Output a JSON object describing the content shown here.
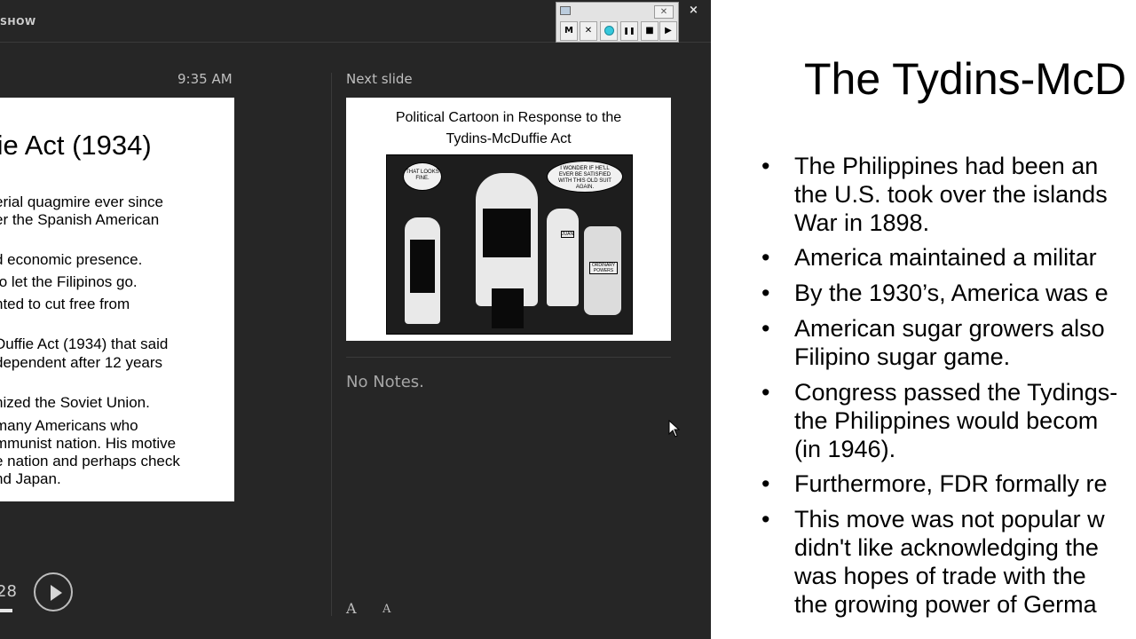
{
  "presenter": {
    "title_fragment": "SHOW",
    "close_glyph": "×",
    "clock": "9:35 AM",
    "timer_fragment": "28",
    "next_slide_label": "Next slide",
    "notes": "No Notes.",
    "font_increase_glyph": "A",
    "font_decrease_glyph": "A"
  },
  "current_slide": {
    "title": "ffie Act (1934)",
    "lines": [
      "erial quagmire ever since",
      "er the Spanish American",
      "d economic presence.",
      "to let the Filipinos go.",
      "nted to cut free from",
      "Duffie Act (1934) that said",
      "dependent after 12 years",
      "nized the Soviet Union.",
      "many Americans who",
      "mmunist nation. His motive",
      "e nation and perhaps check",
      "nd Japan."
    ]
  },
  "next_slide": {
    "title_line1": "Political Cartoon in Response to the",
    "title_line2": "Tydins-McDuffie Act",
    "cartoon": {
      "bubble_left": "THAT LOOKS FINE.",
      "bubble_right": "I WONDER IF HE'LL EVER BE SATISFIED WITH THIS OLD SUIT AGAIN.",
      "sign_juan": "JUAN",
      "sign_powers": "ORDINARY POWERS"
    }
  },
  "recorder": {
    "m_label": "M",
    "x_label": "✕",
    "pause_label": "❚❚",
    "stop_label": "■",
    "play_label": "▶",
    "close_label": "✕",
    "record_color": "#36c8dc"
  },
  "main_slide": {
    "title": "The Tydins-McD",
    "bullet": "•",
    "lines": [
      "The Philippines had been an",
      "the U.S. took over the islands",
      "War in 1898.",
      "America maintained a militar",
      "By the 1930’s, America was e",
      "American sugar growers also",
      "Filipino sugar game.",
      "Congress passed the Tydings-",
      "the Philippines would becom",
      "(in 1946).",
      "Furthermore, FDR formally re",
      "This move was not popular w",
      "didn't like acknowledging the",
      "was hopes of trade with the",
      "the growing power of Germa"
    ]
  }
}
